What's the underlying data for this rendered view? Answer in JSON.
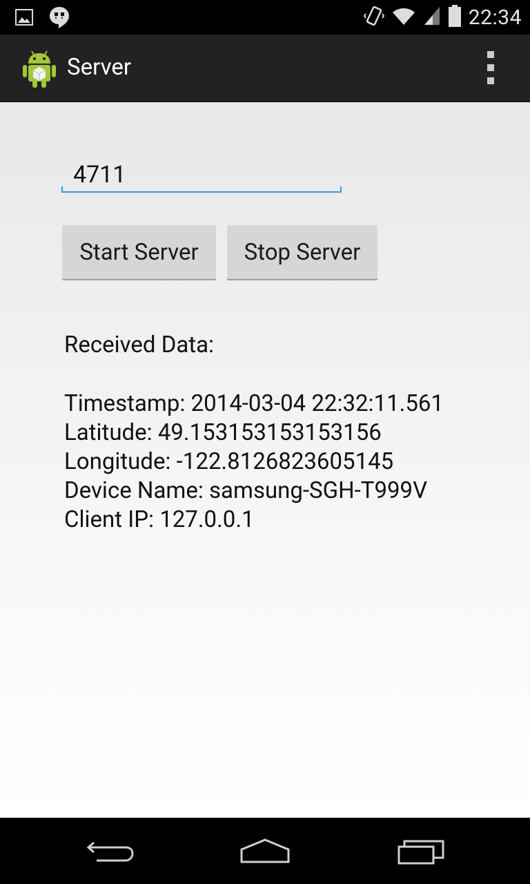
{
  "status_bar": {
    "time": "22:34",
    "icons": [
      "image-notification-icon",
      "hangouts-icon",
      "vibrate-icon",
      "wifi-icon",
      "signal-icon",
      "battery-icon"
    ]
  },
  "action_bar": {
    "title": "Server",
    "app_icon": "android-app-icon",
    "overflow_icon": "overflow-menu-icon"
  },
  "form": {
    "port_value": "4711",
    "start_label": "Start Server",
    "stop_label": "Stop Server"
  },
  "received": {
    "title": "Received Data:",
    "timestamp": "Timestamp: 2014-03-04 22:32:11.561",
    "latitude": "Latitude: 49.153153153153156",
    "longitude": "Longitude: -122.8126823605145",
    "device_name": "Device Name: samsung-SGH-T999V",
    "client_ip": "Client IP: 127.0.0.1"
  },
  "nav_bar": {
    "icons": [
      "back-icon",
      "home-icon",
      "recent-apps-icon"
    ]
  },
  "colors": {
    "accent": "#2f9ccf",
    "action_bar": "#222222",
    "button": "#d6d6d6"
  }
}
